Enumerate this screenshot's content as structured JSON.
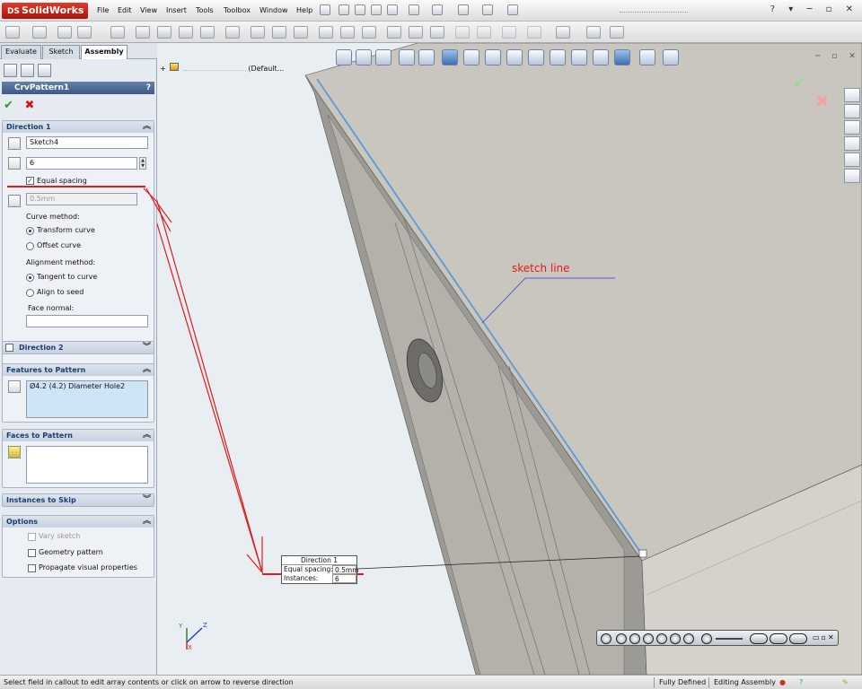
{
  "app": {
    "brand": "SolidWorks",
    "brand_prefix": "DS"
  },
  "menu": [
    "File",
    "Edit",
    "View",
    "Insert",
    "Tools",
    "Toolbox",
    "Window",
    "Help"
  ],
  "window_controls": "? ▾ ─ ▫ ✕",
  "command_manager": {
    "tabs": [
      "Evaluate",
      "Sketch",
      "Assembly"
    ],
    "active_tab": "Assembly"
  },
  "property_manager": {
    "title": "CrvPattern1",
    "help": "?",
    "direction1": {
      "header": "Direction 1",
      "path": "Sketch4",
      "instances": "6",
      "equal_spacing_label": "Equal spacing",
      "equal_spacing_checked": true,
      "spacing": "0.5mm",
      "curve_method_label": "Curve method:",
      "transform_curve": "Transform curve",
      "offset_curve": "Offset curve",
      "alignment_method_label": "Alignment method:",
      "tangent_to_curve": "Tangent to curve",
      "align_to_seed": "Align to seed",
      "face_normal_label": "Face normal:",
      "face_normal_value": ""
    },
    "direction2": {
      "header": "Direction 2"
    },
    "features_to_pattern": {
      "header": "Features to Pattern",
      "items": [
        "Ø4.2 (4.2) Diameter Hole2"
      ]
    },
    "faces_to_pattern": {
      "header": "Faces to Pattern"
    },
    "instances_to_skip": {
      "header": "Instances to Skip"
    },
    "options": {
      "header": "Options",
      "vary_sketch": "Vary sketch",
      "geometry_pattern": "Geometry pattern",
      "propagate_visual": "Propagate visual properties"
    }
  },
  "tree": {
    "root_suffix": "(Default..."
  },
  "callout": {
    "title": "Direction 1",
    "spacing_label": "Equal spacing:",
    "spacing_value": "0.5mm",
    "instances_label": "Instances:",
    "instances_value": "6"
  },
  "annotation": {
    "sketch_line": "sketch line"
  },
  "triad": {
    "x": "X",
    "y": "Y",
    "z": "Z"
  },
  "status_bar": {
    "message": "Select field in callout to edit array contents or click on arrow to reverse direction",
    "state": "Fully Defined",
    "mode": "Editing Assembly"
  },
  "colors": {
    "accent_red": "#e31a1a",
    "sketch_blue": "#5b9bd5",
    "pm_header": "#3d5a8a",
    "ok_green": "#2b9a2b"
  }
}
